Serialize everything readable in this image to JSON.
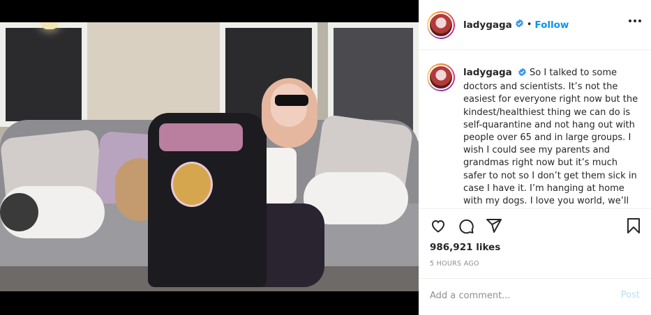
{
  "post": {
    "username": "ladygaga",
    "follow_label": "Follow",
    "separator": "•",
    "caption": "So I talked to some doctors and scientists. It’s not the easiest for everyone right now but the kindest/healthiest thing we can do is self-quarantine and not hang out with people over 65 and in large groups. I wish I could see my parents and grandmas right now but it’s much safer to not so I don’t get them sick in case I have it. I’m hanging at home with my dogs. I love you world, we’ll",
    "likes": "986,921 likes",
    "timestamp": "5 HOURS AGO",
    "comment_placeholder": "Add a comment...",
    "post_label": "Post"
  },
  "icons": {
    "verified": "verified-badge-icon",
    "more": "more-options-icon",
    "like": "heart-icon",
    "comment": "comment-icon",
    "share": "share-icon",
    "save": "bookmark-icon"
  },
  "colors": {
    "accent": "#0095f6",
    "post_disabled": "#b2dffc",
    "muted": "#8e8e8e",
    "text": "#262626"
  }
}
